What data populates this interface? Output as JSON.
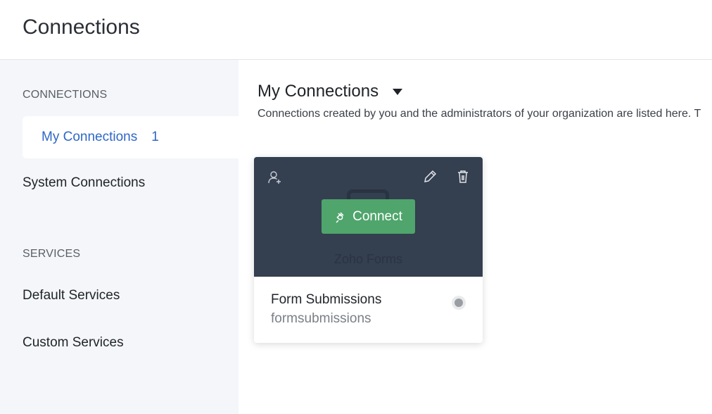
{
  "header": {
    "title": "Connections"
  },
  "sidebar": {
    "connections_label": "CONNECTIONS",
    "items": [
      {
        "label": "My Connections",
        "count": "1"
      },
      {
        "label": "System Connections"
      }
    ],
    "services_label": "SERVICES",
    "service_items": [
      {
        "label": "Default Services"
      },
      {
        "label": "Custom Services"
      }
    ]
  },
  "main": {
    "title": "My Connections",
    "description": "Connections created by you and the administrators of your organization are listed here. T"
  },
  "card": {
    "service_name": "Zoho Forms",
    "connect_label": "Connect",
    "connection_name": "Form Submissions",
    "link_name": "formsubmissions",
    "icons": [
      "user-add-icon",
      "pencil-icon",
      "trash-icon",
      "plug-icon"
    ],
    "colors": {
      "card_header": "#343f50",
      "connect_button": "#4fa56c",
      "active_nav": "#2e67c8"
    }
  }
}
